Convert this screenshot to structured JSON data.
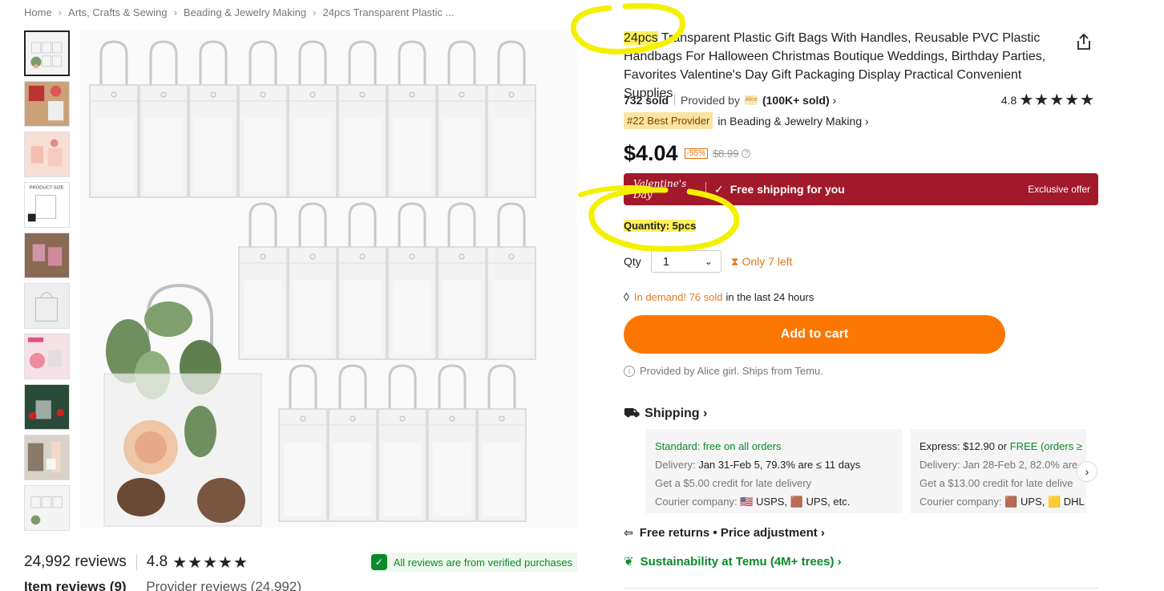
{
  "breadcrumb": {
    "items": [
      "Home",
      "Arts, Crafts & Sewing",
      "Beading & Jewelry Making",
      "24pcs Transparent Plastic ..."
    ],
    "separator": "›"
  },
  "product": {
    "title_highlight": "24pcs",
    "title_rest": " Transparent Plastic Gift Bags With Handles, Reusable PVC Plastic Handbags For Halloween Christmas Boutique Weddings, Birthday Parties, Favorites Valentine's Day Gift Packaging Display Practical Convenient Supplies",
    "sold": "732 sold",
    "provided_by": "Provided by",
    "provider_logo": "Alice",
    "provider_sold": "(100K+ sold)",
    "rating": "4.8",
    "stars": "★★★★★",
    "best_badge": "#22 Best Provider",
    "best_category": "in Beading & Jewelry Making",
    "price": "$4.04",
    "discount": "-55%",
    "original_price": "$8.99"
  },
  "promo": {
    "event": "Valentine's Day",
    "check": "✓",
    "free_shipping": "Free shipping for you",
    "exclusive": "Exclusive offer",
    "bg_color": "#a2192b"
  },
  "quantity": {
    "label": "Quantity: 5pcs",
    "qty_label": "Qty",
    "qty_value": "1",
    "only_left": "Only 7 left"
  },
  "demand": {
    "highlight": "In demand! 76 sold",
    "rest": "in the last 24 hours"
  },
  "actions": {
    "add_to_cart": "Add to cart",
    "accent_color": "#fb7701"
  },
  "provided_note": "Provided by Alice girl. Ships from Temu.",
  "shipping": {
    "heading": "Shipping",
    "standard": {
      "title": "Standard: free on all orders",
      "delivery_label": "Delivery:",
      "delivery": "Jan 31-Feb 5, 79.3% are ≤ 11 days",
      "credit": "Get a $5.00 credit for late delivery",
      "courier_label": "Courier company:",
      "couriers": "🇺🇸 USPS, 🟫 UPS, etc."
    },
    "express": {
      "title_prefix": "Express: $12.90 or ",
      "title_free": "FREE (orders ≥",
      "delivery_label": "Delivery:",
      "delivery": "Jan 28-Feb 2, 82.0% are",
      "credit": "Get a $13.00 credit for late delive",
      "courier_label": "Courier company:",
      "couriers": "🟫 UPS, 🟨 DHL"
    }
  },
  "returns": "Free returns • Price adjustment",
  "sustainability": "Sustainability at Temu (4M+ trees)",
  "reviews": {
    "count": "24,992 reviews",
    "rating": "4.8",
    "stars": "★★★★★",
    "verified": "All reviews are from verified purchases",
    "tab_item": "Item reviews (9)",
    "tab_provider": "Provider reviews (24,992)"
  },
  "thumbnails": [
    "bags-stack",
    "gift-scene",
    "pink-bags",
    "product-size",
    "outdoor-bags",
    "single-bag",
    "pink-decor",
    "christmas-bags",
    "model-bag",
    "bags-stack-2"
  ],
  "annotation_color": "#f5f000"
}
